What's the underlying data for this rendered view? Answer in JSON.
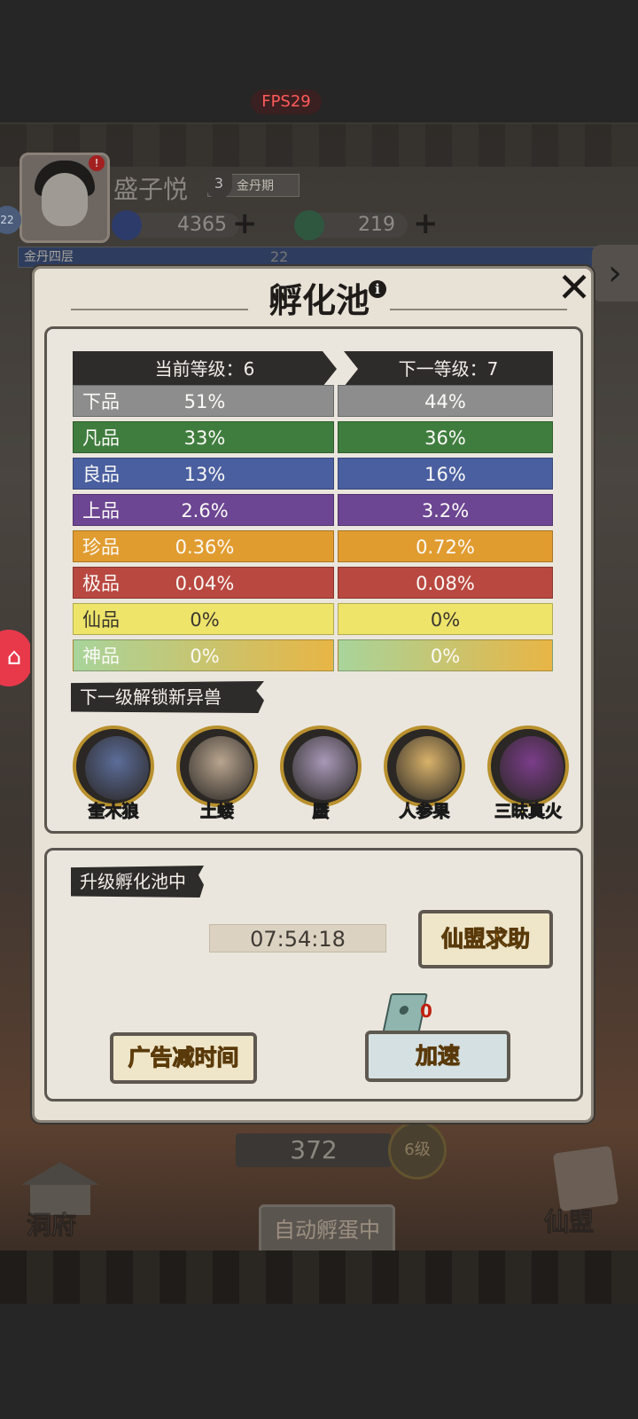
{
  "status": {
    "fps": "FPS29"
  },
  "player": {
    "name": "盛子悦",
    "realm_level": "3",
    "realm": "金丹期",
    "notify": "!",
    "side_level": "22",
    "stage": "金丹四层",
    "exp_value": "22"
  },
  "resources": [
    {
      "icon": "blue-gem-icon",
      "value": "4365",
      "plus": "+"
    },
    {
      "icon": "green-spirit-icon",
      "value": "219",
      "plus": "+"
    }
  ],
  "background": {
    "counter": "372",
    "level_badge": "6级",
    "auto_hatch": "自动孵蛋中",
    "cave": "洞府",
    "alliance": "仙盟"
  },
  "modal": {
    "title": "孵化池",
    "info": "i",
    "close": "✕",
    "current_level": "当前等级：6",
    "next_level": "下一等级：7",
    "grades": [
      {
        "name": "下品",
        "current": "51%",
        "next": "44%",
        "color": "#8d8d8d"
      },
      {
        "name": "凡品",
        "current": "33%",
        "next": "36%",
        "color": "#3f7d3e"
      },
      {
        "name": "良品",
        "current": "13%",
        "next": "16%",
        "color": "#4a5fa0"
      },
      {
        "name": "上品",
        "current": "2.6%",
        "next": "3.2%",
        "color": "#6c4593"
      },
      {
        "name": "珍品",
        "current": "0.36%",
        "next": "0.72%",
        "color": "#e19c30"
      },
      {
        "name": "极品",
        "current": "0.04%",
        "next": "0.08%",
        "color": "#b94841"
      },
      {
        "name": "仙品",
        "current": "0%",
        "next": "0%",
        "color": "#eee46a"
      },
      {
        "name": "神品",
        "current": "0%",
        "next": "0%",
        "color": "#a8d49b"
      }
    ],
    "unlock_title": "下一级解锁新异兽",
    "beasts": [
      {
        "name": "奎木狼",
        "color": "#5c6d9a"
      },
      {
        "name": "土蝼",
        "color": "#b9a58f"
      },
      {
        "name": "蜃",
        "color": "#a899b8"
      },
      {
        "name": "人参果",
        "color": "#d9b26a"
      },
      {
        "name": "三昧真火",
        "color": "#7b3d8a"
      }
    ],
    "upgrade_title": "升级孵化池中",
    "timer": "07:54:18",
    "help_button": "仙盟求助",
    "ad_button": "广告减时间",
    "speed_button": "加速",
    "ticket_count": "0"
  }
}
